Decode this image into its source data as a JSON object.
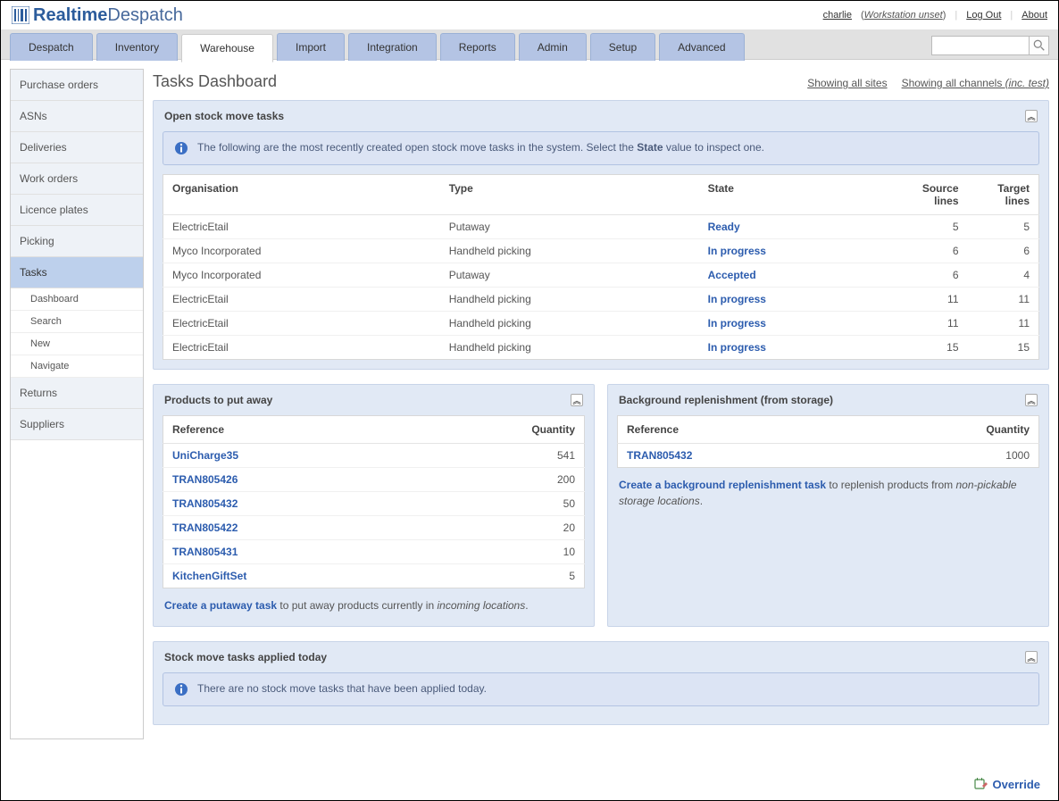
{
  "brand": {
    "name1": "Realtime",
    "name2": "Despatch"
  },
  "header": {
    "user": "charlie",
    "workstation": "Workstation unset",
    "logout": "Log Out",
    "about": "About"
  },
  "tabs": [
    "Despatch",
    "Inventory",
    "Warehouse",
    "Import",
    "Integration",
    "Reports",
    "Admin",
    "Setup",
    "Advanced"
  ],
  "active_tab": "Warehouse",
  "search": {
    "placeholder": ""
  },
  "sidebar": {
    "items": [
      "Purchase orders",
      "ASNs",
      "Deliveries",
      "Work orders",
      "Licence plates",
      "Picking",
      "Tasks",
      "Returns",
      "Suppliers"
    ],
    "selected": "Tasks",
    "subs": [
      "Dashboard",
      "Search",
      "New",
      "Navigate"
    ]
  },
  "page": {
    "title": "Tasks Dashboard",
    "filter_sites": "Showing all sites",
    "filter_channels_pre": "Showing all channels ",
    "filter_channels_inc": "(inc. test)"
  },
  "open_tasks": {
    "title": "Open stock move tasks",
    "info_pre": "The following are the most recently created open stock move tasks in the system. Select the ",
    "info_bold": "State",
    "info_post": " value to inspect one.",
    "cols": {
      "org": "Organisation",
      "type": "Type",
      "state": "State",
      "src": "Source lines",
      "tgt": "Target lines"
    },
    "rows": [
      {
        "org": "ElectricEtail",
        "type": "Putaway",
        "state": "Ready",
        "src": "5",
        "tgt": "5",
        "tred": false
      },
      {
        "org": "Myco Incorporated",
        "type": "Handheld picking",
        "state": "In progress",
        "src": "6",
        "tgt": "6",
        "tred": false
      },
      {
        "org": "Myco Incorporated",
        "type": "Putaway",
        "state": "Accepted",
        "src": "6",
        "tgt": "4",
        "tred": true
      },
      {
        "org": "ElectricEtail",
        "type": "Handheld picking",
        "state": "In progress",
        "src": "11",
        "tgt": "11",
        "tred": false
      },
      {
        "org": "ElectricEtail",
        "type": "Handheld picking",
        "state": "In progress",
        "src": "11",
        "tgt": "11",
        "tred": false
      },
      {
        "org": "ElectricEtail",
        "type": "Handheld picking",
        "state": "In progress",
        "src": "15",
        "tgt": "15",
        "tred": false
      }
    ]
  },
  "putaway": {
    "title": "Products to put away",
    "cols": {
      "ref": "Reference",
      "qty": "Quantity"
    },
    "rows": [
      {
        "ref": "UniCharge35",
        "qty": "541"
      },
      {
        "ref": "TRAN805426",
        "qty": "200"
      },
      {
        "ref": "TRAN805432",
        "qty": "50"
      },
      {
        "ref": "TRAN805422",
        "qty": "20"
      },
      {
        "ref": "TRAN805431",
        "qty": "10"
      },
      {
        "ref": "KitchenGiftSet",
        "qty": "5"
      }
    ],
    "note_link": "Create a putaway task",
    "note_mid": " to put away products currently in ",
    "note_em": "incoming locations",
    "note_end": "."
  },
  "replen": {
    "title": "Background replenishment (from storage)",
    "cols": {
      "ref": "Reference",
      "qty": "Quantity"
    },
    "rows": [
      {
        "ref": "TRAN805432",
        "qty": "1000"
      }
    ],
    "note_link": "Create a background replenishment task",
    "note_mid": " to replenish products from ",
    "note_em": "non-pickable storage locations",
    "note_end": "."
  },
  "applied": {
    "title": "Stock move tasks applied today",
    "info": "There are no stock move tasks that have been applied today."
  },
  "override": "Override"
}
